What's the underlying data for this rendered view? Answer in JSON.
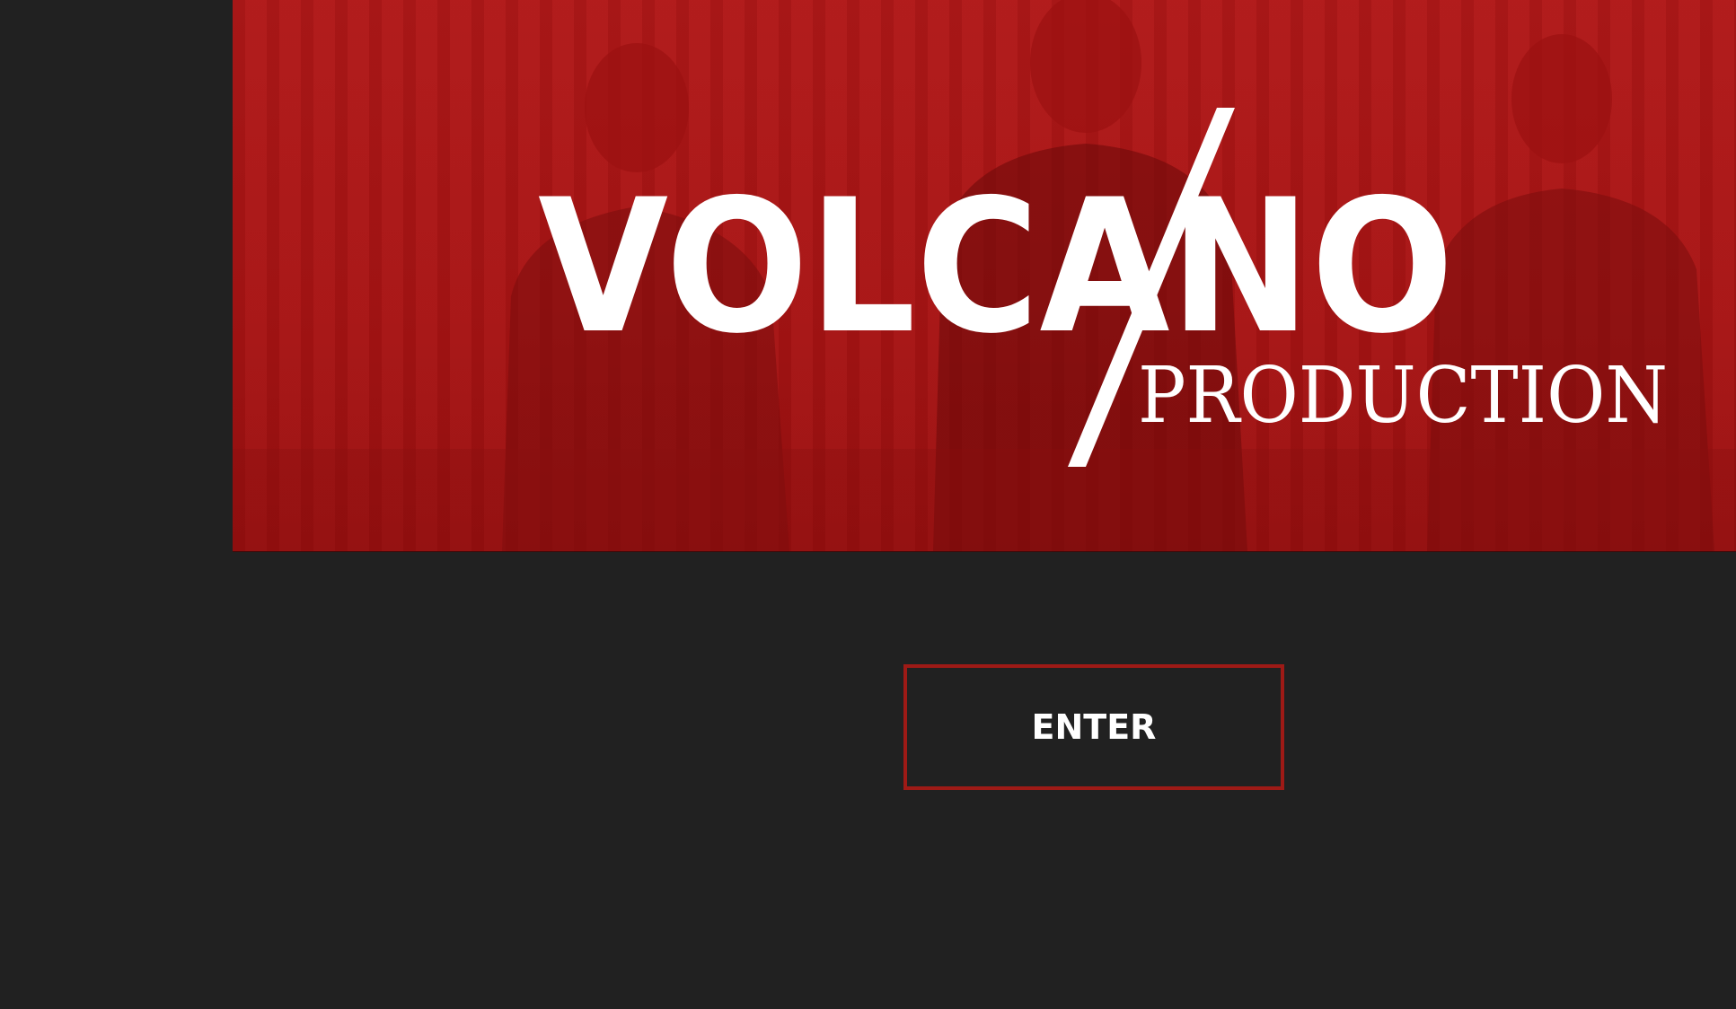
{
  "hero": {
    "logo_word": "VOLCANO",
    "logo_subtitle": "PRODUCTION"
  },
  "enter_button": {
    "label": "ENTER"
  },
  "colors": {
    "background": "#212121",
    "hero_red": "#a81414",
    "button_border": "#9e1a16",
    "text": "#ffffff"
  }
}
